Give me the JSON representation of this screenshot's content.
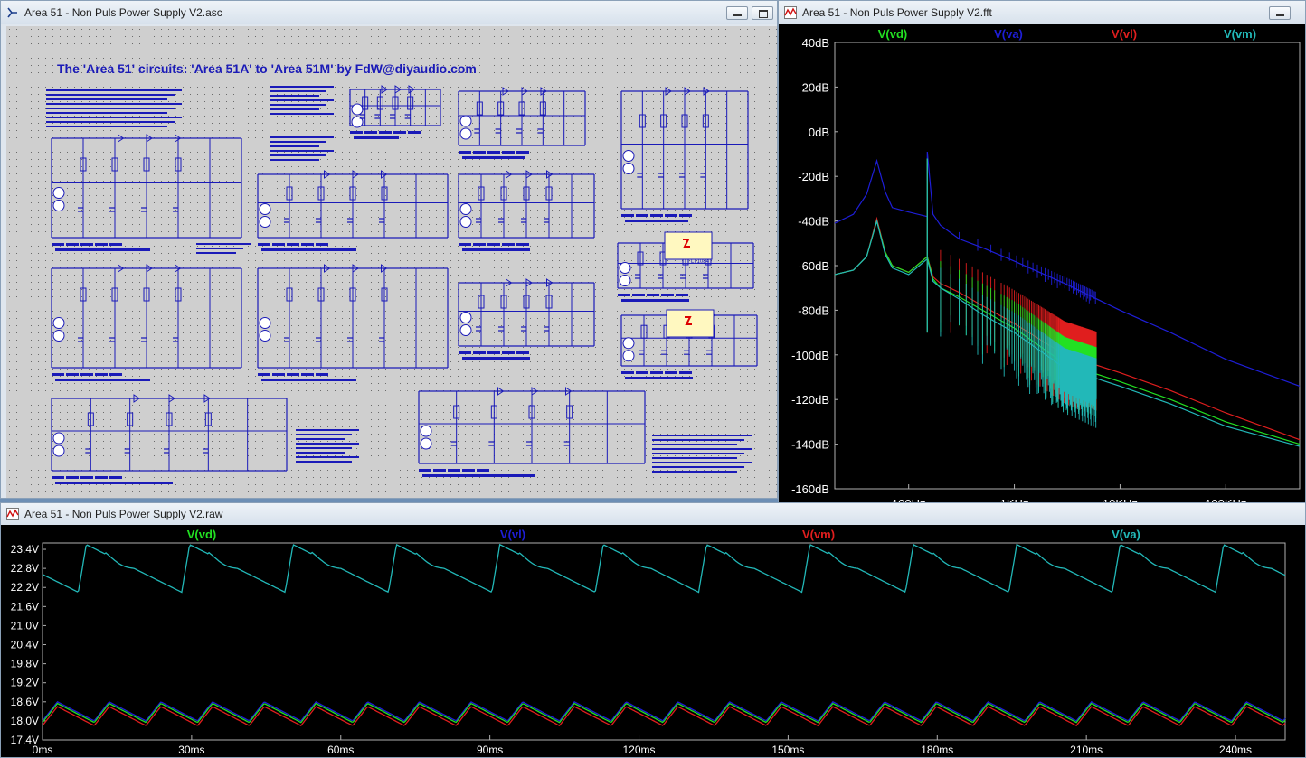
{
  "schematic_window": {
    "title": "Area 51 - Non Puls Power Supply V2.asc",
    "heading": "The 'Area 51' circuits: 'Area 51A' to 'Area 51M' by FdW@diyaudio.com",
    "box_label": "LT1084",
    "colors": {
      "background": "#cfcfcf",
      "wire": "#1a1ab8",
      "text": "#1a1ab8",
      "part_fill": "#fff8c0"
    }
  },
  "fft_window": {
    "title": "Area 51 - Non Puls Power Supply V2.fft",
    "colors": {
      "background": "#000000",
      "axis_text": "#ffffff"
    },
    "legend": [
      {
        "name": "V(vd)",
        "color": "#22e022"
      },
      {
        "name": "V(va)",
        "color": "#1e1ed8"
      },
      {
        "name": "V(vl)",
        "color": "#e01e1e"
      },
      {
        "name": "V(vm)",
        "color": "#22b8b8"
      }
    ]
  },
  "raw_window": {
    "title": "Area 51 - Non Puls Power Supply V2.raw",
    "colors": {
      "background": "#000000",
      "axis_text": "#ffffff"
    },
    "legend": [
      {
        "name": "V(vd)",
        "color": "#22e022"
      },
      {
        "name": "V(vl)",
        "color": "#1e1ed8"
      },
      {
        "name": "V(vm)",
        "color": "#e01e1e"
      },
      {
        "name": "V(va)",
        "color": "#22b8b8"
      }
    ]
  },
  "chart_data": [
    {
      "type": "line",
      "x_scale": "log",
      "xlabels": [
        "100Hz",
        "1KHz",
        "10KHz",
        "100KHz"
      ],
      "x_ticks": [
        100,
        1000,
        10000,
        100000
      ],
      "xlim": [
        20,
        500000
      ],
      "ylabels": [
        "40dB",
        "20dB",
        "0dB",
        "-20dB",
        "-40dB",
        "-60dB",
        "-80dB",
        "-100dB",
        "-120dB",
        "-140dB",
        "-160dB"
      ],
      "ylim": [
        -160,
        40
      ],
      "series": [
        {
          "name": "V(va)",
          "color": "#1e1ed8",
          "x": [
            20,
            30,
            40,
            50,
            60,
            70,
            100,
            150,
            150,
            170,
            200,
            300,
            500,
            1000,
            3000,
            10000,
            30000,
            100000,
            500000
          ],
          "y": [
            -41,
            -37,
            -28,
            -13,
            -27,
            -34,
            -36,
            -38,
            -9,
            -37,
            -42,
            -48,
            -52,
            -58,
            -68,
            -80,
            -90,
            -102,
            -114
          ]
        },
        {
          "name": "V(vl)",
          "color": "#e01e1e",
          "x": [
            20,
            30,
            40,
            50,
            60,
            70,
            100,
            150,
            170,
            200,
            300,
            500,
            1000,
            3000,
            10000,
            30000,
            100000,
            500000
          ],
          "y": [
            -64,
            -62,
            -56,
            -39,
            -54,
            -60,
            -63,
            -56,
            -65,
            -68,
            -72,
            -78,
            -86,
            -100,
            -108,
            -116,
            -126,
            -138
          ]
        },
        {
          "name": "V(vd)",
          "color": "#22e022",
          "x": [
            20,
            30,
            40,
            50,
            60,
            70,
            100,
            150,
            170,
            200,
            300,
            500,
            1000,
            3000,
            10000,
            30000,
            100000,
            500000
          ],
          "y": [
            -64,
            -62,
            -56,
            -40,
            -54,
            -60,
            -63,
            -56,
            -66,
            -70,
            -74,
            -80,
            -88,
            -104,
            -112,
            -120,
            -130,
            -140
          ]
        },
        {
          "name": "V(vm)",
          "color": "#22b8b8",
          "x": [
            20,
            30,
            40,
            50,
            60,
            70,
            100,
            150,
            170,
            200,
            300,
            500,
            1000,
            3000,
            10000,
            30000,
            100000,
            500000
          ],
          "y": [
            -64,
            -62,
            -56,
            -40,
            -55,
            -61,
            -64,
            -57,
            -67,
            -70,
            -75,
            -82,
            -90,
            -106,
            -114,
            -122,
            -132,
            -141
          ]
        }
      ]
    },
    {
      "type": "line",
      "xlabels": [
        "0ms",
        "30ms",
        "60ms",
        "90ms",
        "120ms",
        "150ms",
        "180ms",
        "210ms",
        "240ms"
      ],
      "x_ticks": [
        0,
        30,
        60,
        90,
        120,
        150,
        180,
        210,
        240
      ],
      "xlim": [
        0,
        250
      ],
      "ylabels": [
        "23.4V",
        "22.8V",
        "22.2V",
        "21.6V",
        "21.0V",
        "20.4V",
        "19.8V",
        "19.2V",
        "18.6V",
        "18.0V",
        "17.4V"
      ],
      "ylim": [
        17.4,
        23.6
      ],
      "period_ms": 20.8,
      "series": [
        {
          "name": "V(va)",
          "color": "#22b8b8",
          "min": 22.05,
          "max": 23.55
        },
        {
          "name": "V(vl)",
          "color": "#1e1ed8",
          "min": 18.0,
          "max": 18.6
        },
        {
          "name": "V(vd)",
          "color": "#22e022",
          "min": 17.95,
          "max": 18.55
        },
        {
          "name": "V(vm)",
          "color": "#e01e1e",
          "min": 17.85,
          "max": 18.45
        }
      ]
    }
  ]
}
